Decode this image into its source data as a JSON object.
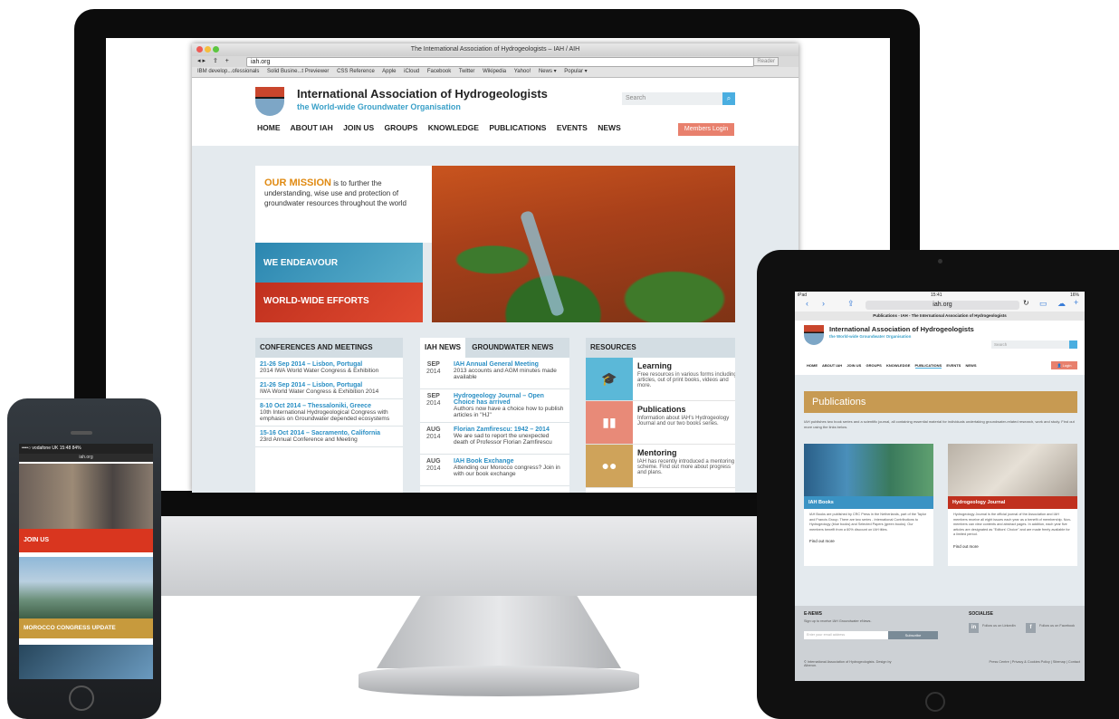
{
  "browser": {
    "title": "The International Association of Hydrogeologists – IAH / AIH",
    "url": "iah.org",
    "reader": "Reader",
    "bookmarks": [
      "IBM develop...ofessionals",
      "Solid Busine...t Previewer",
      "CSS Reference",
      "Apple",
      "iCloud",
      "Facebook",
      "Twitter",
      "Wikipedia",
      "Yahoo!",
      "News ▾",
      "Popular ▾"
    ]
  },
  "site": {
    "title": "International Association of Hydrogeologists",
    "subtitle": "the World-wide Groundwater Organisation",
    "search_placeholder": "Search",
    "nav": [
      "HOME",
      "ABOUT IAH",
      "JOIN US",
      "GROUPS",
      "KNOWLEDGE",
      "PUBLICATIONS",
      "EVENTS",
      "NEWS"
    ],
    "login": "Members Login",
    "mission_lead": "OUR MISSION",
    "mission_text": "is to further the understanding, wise use and protection of groundwater resources throughout the world",
    "endeavour": "WE ENDEAVOUR",
    "efforts": "WORLD-WIDE EFFORTS",
    "conferences": {
      "heading": "CONFERENCES AND MEETINGS",
      "items": [
        {
          "title": "21-26 Sep 2014 – Lisbon, Portugal",
          "text": "2014 IWA World Water Congress & Exhibition"
        },
        {
          "title": "21-26 Sep 2014 – Lisbon, Portugal",
          "text": "IWA World Water Congress & Exhibition 2014"
        },
        {
          "title": "8-10 Oct 2014 – Thessaloniki, Greece",
          "text": "10th International Hydrogeological Congress with emphasis on Groundwater depended ecosystems"
        },
        {
          "title": "15-16 Oct 2014 – Sacramento, California",
          "text": "23rd Annual Conference and Meeting"
        }
      ]
    },
    "news": {
      "tab1": "IAH NEWS",
      "tab2": "GROUNDWATER NEWS",
      "items": [
        {
          "month": "SEP",
          "year": "2014",
          "title": "IAH Annual General Meeting",
          "text": "2013 accounts and AGM minutes made available"
        },
        {
          "month": "SEP",
          "year": "2014",
          "title": "Hydrogeology Journal – Open Choice has arrived",
          "text": "Authors now have a choice how to publish articles in \"HJ\""
        },
        {
          "month": "AUG",
          "year": "2014",
          "title": "Florian Zamfirescu: 1942 – 2014",
          "text": "We are sad to report the unexpected death of Professor Florian Zamfirescu"
        },
        {
          "month": "AUG",
          "year": "2014",
          "title": "IAH Book Exchange",
          "text": "Attending our Morocco congress? Join in with our book exchange"
        }
      ]
    },
    "resources": {
      "heading": "RESOURCES",
      "items": [
        {
          "title": "Learning",
          "text": "Free resources in various forms including articles, out of print books, videos and more.",
          "icon": "graduation-cap-icon",
          "color": "#5bb8d8"
        },
        {
          "title": "Publications",
          "text": "Information about IAH's Hydrogeology Journal and our two books series.",
          "icon": "book-icon",
          "color": "#e88a78"
        },
        {
          "title": "Mentoring",
          "text": "IAH has recently introduced a mentoring scheme. Find out more about progress and plans.",
          "icon": "people-icon",
          "color": "#cfa35a"
        }
      ]
    }
  },
  "phone": {
    "status": "••••○ vodafone UK  15:48   84%",
    "url": "iah.org",
    "join": "JOIN US",
    "morocco": "MOROCCO CONGRESS UPDATE"
  },
  "ipad": {
    "status_left": "iPad",
    "time": "15:41",
    "battery": "16%",
    "url": "iah.org",
    "tab_title": "Publications - IAH - The International Association of Hydrogeologists",
    "title": "International Association of Hydrogeologists",
    "subtitle": "the World-wide Groundwater Organisation",
    "search": "Search",
    "menu": [
      "HOME",
      "ABOUT IAH",
      "JOIN US",
      "GROUPS",
      "KNOWLEDGE",
      "PUBLICATIONS",
      "EVENTS",
      "NEWS"
    ],
    "login": "Login",
    "page_heading": "Publications",
    "intro": "IAH publishes two book series and a scientific journal, all containing essential material for individuals undertaking groundwater-related research, work and study. Find out more using the links below.",
    "card1": {
      "label": "IAH Books",
      "text": "IAH Books are published by CRC Press in the Netherlands, part of the Taylor and Francis Group. There are two series - International Contributions to Hydrogeology (blue books) and Selected Papers (green books). Our members benefit from a 60% discount on IAH titles.",
      "more": "Find out more"
    },
    "card2": {
      "label": "Hydrogeology Journal",
      "text": "Hydrogeology Journal is the official journal of the Association and IAH members receive all eight issues each year as a benefit of membership. Non-members can view contents and abstract pages. In addition, each year five articles are designated as \"Editors' Choice\" and are made freely available for a limited period.",
      "more": "Find out more"
    },
    "enews_heading": "E-NEWS",
    "enews_text": "Sign up to receive IAH Groundwater eNews.",
    "email_placeholder": "Enter your email address",
    "subscribe": "Subscribe",
    "social_heading": "SOCIALISE",
    "linkedin": "Follow us on LinkedIn",
    "facebook": "Follow us on Facebook",
    "copyright": "© International Association of Hydrogeologists. Design by Alberon.",
    "footer_links": "Press Centre  |  Privacy & Cookies Policy  |  Sitemap  |  Contact"
  }
}
